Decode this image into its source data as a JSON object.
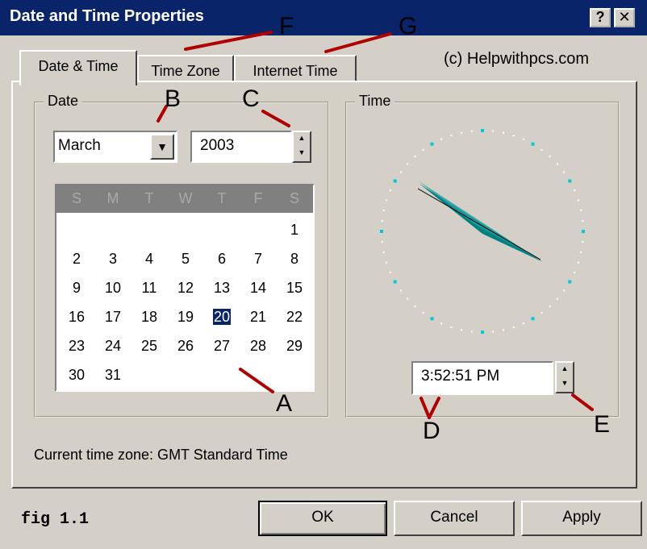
{
  "window": {
    "title": "Date and Time Properties",
    "help_button": "?",
    "close_button": "✕"
  },
  "tabs": [
    {
      "label": "Date & Time",
      "active": true
    },
    {
      "label": "Time Zone",
      "active": false
    },
    {
      "label": "Internet Time",
      "active": false
    }
  ],
  "credit": "(c) Helpwithpcs.com",
  "date_group": {
    "label": "Date",
    "month": "March",
    "year": "2003"
  },
  "calendar": {
    "weekday_headers": [
      "S",
      "M",
      "T",
      "W",
      "T",
      "F",
      "S"
    ],
    "weeks": [
      [
        "",
        "",
        "",
        "",
        "",
        "",
        "1"
      ],
      [
        "2",
        "3",
        "4",
        "5",
        "6",
        "7",
        "8"
      ],
      [
        "9",
        "10",
        "11",
        "12",
        "13",
        "14",
        "15"
      ],
      [
        "16",
        "17",
        "18",
        "19",
        "20",
        "21",
        "22"
      ],
      [
        "23",
        "24",
        "25",
        "26",
        "27",
        "28",
        "29"
      ],
      [
        "30",
        "31",
        "",
        "",
        "",
        "",
        ""
      ]
    ],
    "selected_day": "20"
  },
  "time_group": {
    "label": "Time",
    "time_value": "3:52:51 PM"
  },
  "timezone_text": "Current time zone:  GMT Standard Time",
  "buttons": {
    "ok": "OK",
    "cancel": "Cancel",
    "apply": "Apply"
  },
  "caption": "fig 1.1",
  "annotations": {
    "a": "A",
    "b": "B",
    "c": "C",
    "d": "D",
    "e": "E",
    "f": "F",
    "g": "G"
  },
  "colors": {
    "title_bar": "#0a246a",
    "annotation": "#b00000",
    "clock_hand": "#008080",
    "clock_dot": "#00c8d8"
  },
  "icons": {
    "spin_up": "triangle-up",
    "spin_down": "triangle-down",
    "dropdown": "triangle-down"
  }
}
